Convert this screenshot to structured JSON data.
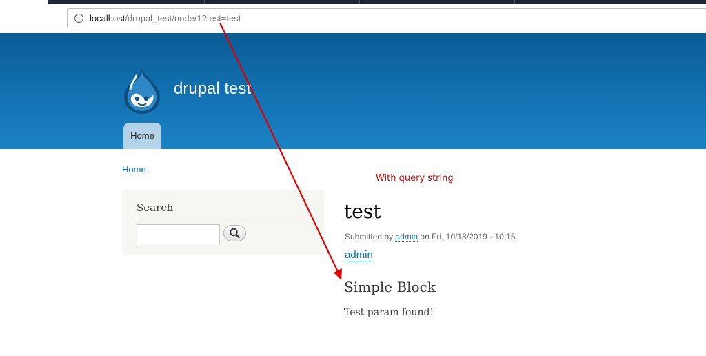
{
  "browser": {
    "url_host": "localhost",
    "url_path": "/drupal_test/node/1?test=test"
  },
  "site": {
    "name": "drupal test",
    "nav": {
      "home_tab": "Home"
    }
  },
  "breadcrumb": {
    "home": "Home"
  },
  "sidebar": {
    "search_title": "Search",
    "search_value": ""
  },
  "annotation": {
    "text": "With query string",
    "color": "#e00000"
  },
  "node": {
    "title": "test",
    "submitted_prefix": "Submitted by",
    "author": "admin",
    "submitted_suffix": "on Fri, 10/18/2019 - 10:15",
    "author_link": "admin"
  },
  "block": {
    "title": "Simple Block",
    "body": "Test param found!"
  },
  "colors": {
    "header_top": "#0b5c95",
    "header_bottom": "#1a82c3",
    "link": "#0071b3",
    "annotation_arrow": "#e00000"
  },
  "icons": [
    "info-icon",
    "drupal-logo",
    "search-icon"
  ]
}
